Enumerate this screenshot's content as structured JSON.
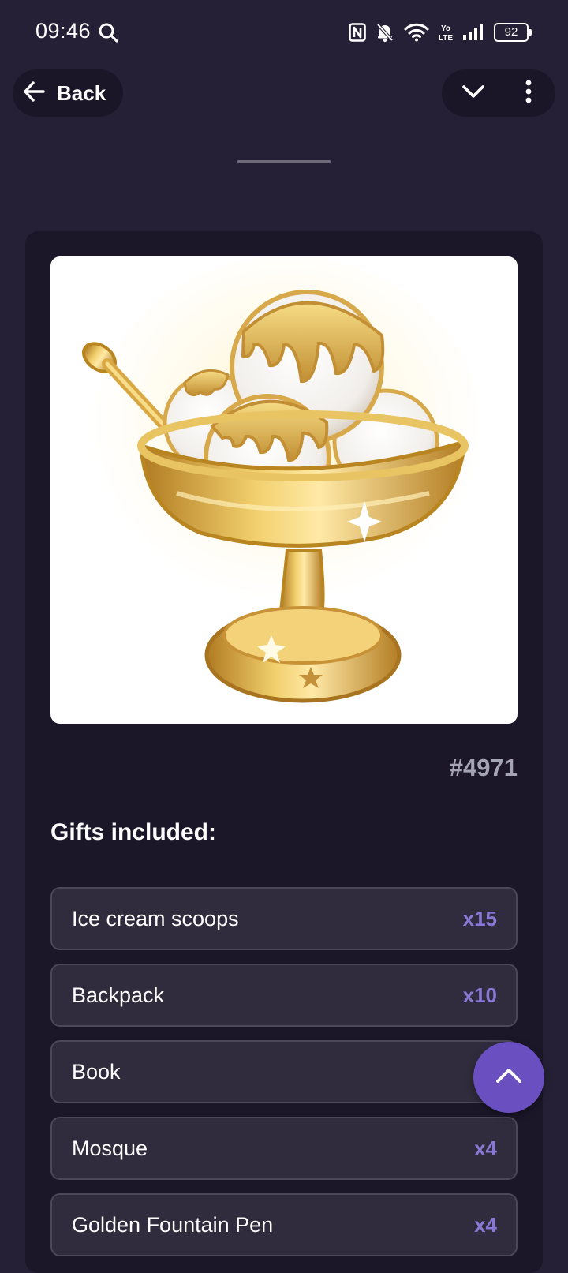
{
  "status_bar": {
    "time": "09:46",
    "battery": "92",
    "icons": [
      "search-icon",
      "nfc-icon",
      "bell-muted-icon",
      "wifi-icon",
      "volte-icon",
      "signal-icon",
      "battery-icon"
    ]
  },
  "header": {
    "back_label": "Back",
    "collapse_icon": "chevron-down-icon",
    "menu_icon": "more-vertical-icon"
  },
  "gift": {
    "image_icon": "golden-ice-cream-sundae",
    "number": "#4971",
    "included_heading": "Gifts included:",
    "items": [
      {
        "name": "Ice cream scoops",
        "qty": "x15"
      },
      {
        "name": "Backpack",
        "qty": "x10"
      },
      {
        "name": "Book",
        "qty": ""
      },
      {
        "name": "Mosque",
        "qty": "x4"
      },
      {
        "name": "Golden Fountain Pen",
        "qty": "x4"
      }
    ]
  },
  "fab": {
    "icon": "chevron-up-icon"
  },
  "colors": {
    "background": "#262036",
    "card": "#1b1729",
    "row": "#302c3d",
    "accent": "#6a4fc0",
    "quantity": "#8b78d6",
    "gold": "#e0b04a"
  }
}
